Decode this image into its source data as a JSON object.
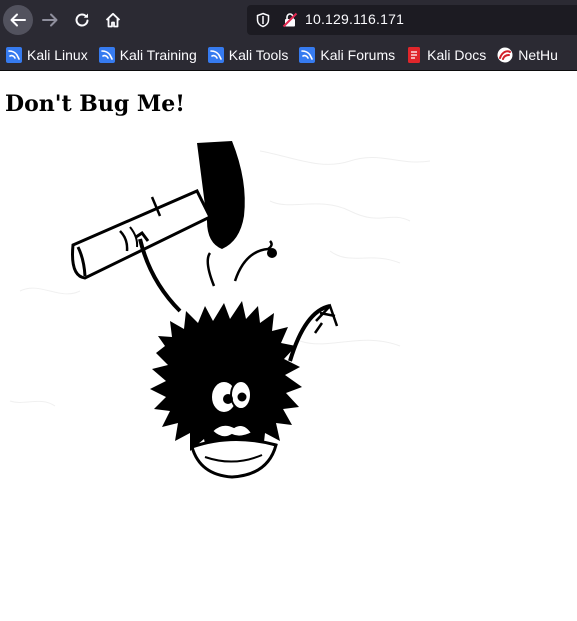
{
  "browser": {
    "url": "10.129.116.171",
    "bookmarks": [
      {
        "label": "Kali Linux",
        "icon": "kali-dragon-icon"
      },
      {
        "label": "Kali Training",
        "icon": "kali-dragon-icon"
      },
      {
        "label": "Kali Tools",
        "icon": "kali-dragon-icon"
      },
      {
        "label": "Kali Forums",
        "icon": "kali-dragon-icon"
      },
      {
        "label": "Kali Docs",
        "icon": "kali-docs-icon"
      },
      {
        "label": "NetHu",
        "icon": "nethunter-icon"
      }
    ]
  },
  "page": {
    "heading": "Don't Bug Me!",
    "image_icon": "cartoon-bug-with-flyswatter"
  },
  "colors": {
    "toolbar": "#2b2a33",
    "urlbar": "#1c1b22",
    "text_light": "#fbfbfe",
    "kali_blue": "#367bf0",
    "docs_red": "#e0262b"
  }
}
